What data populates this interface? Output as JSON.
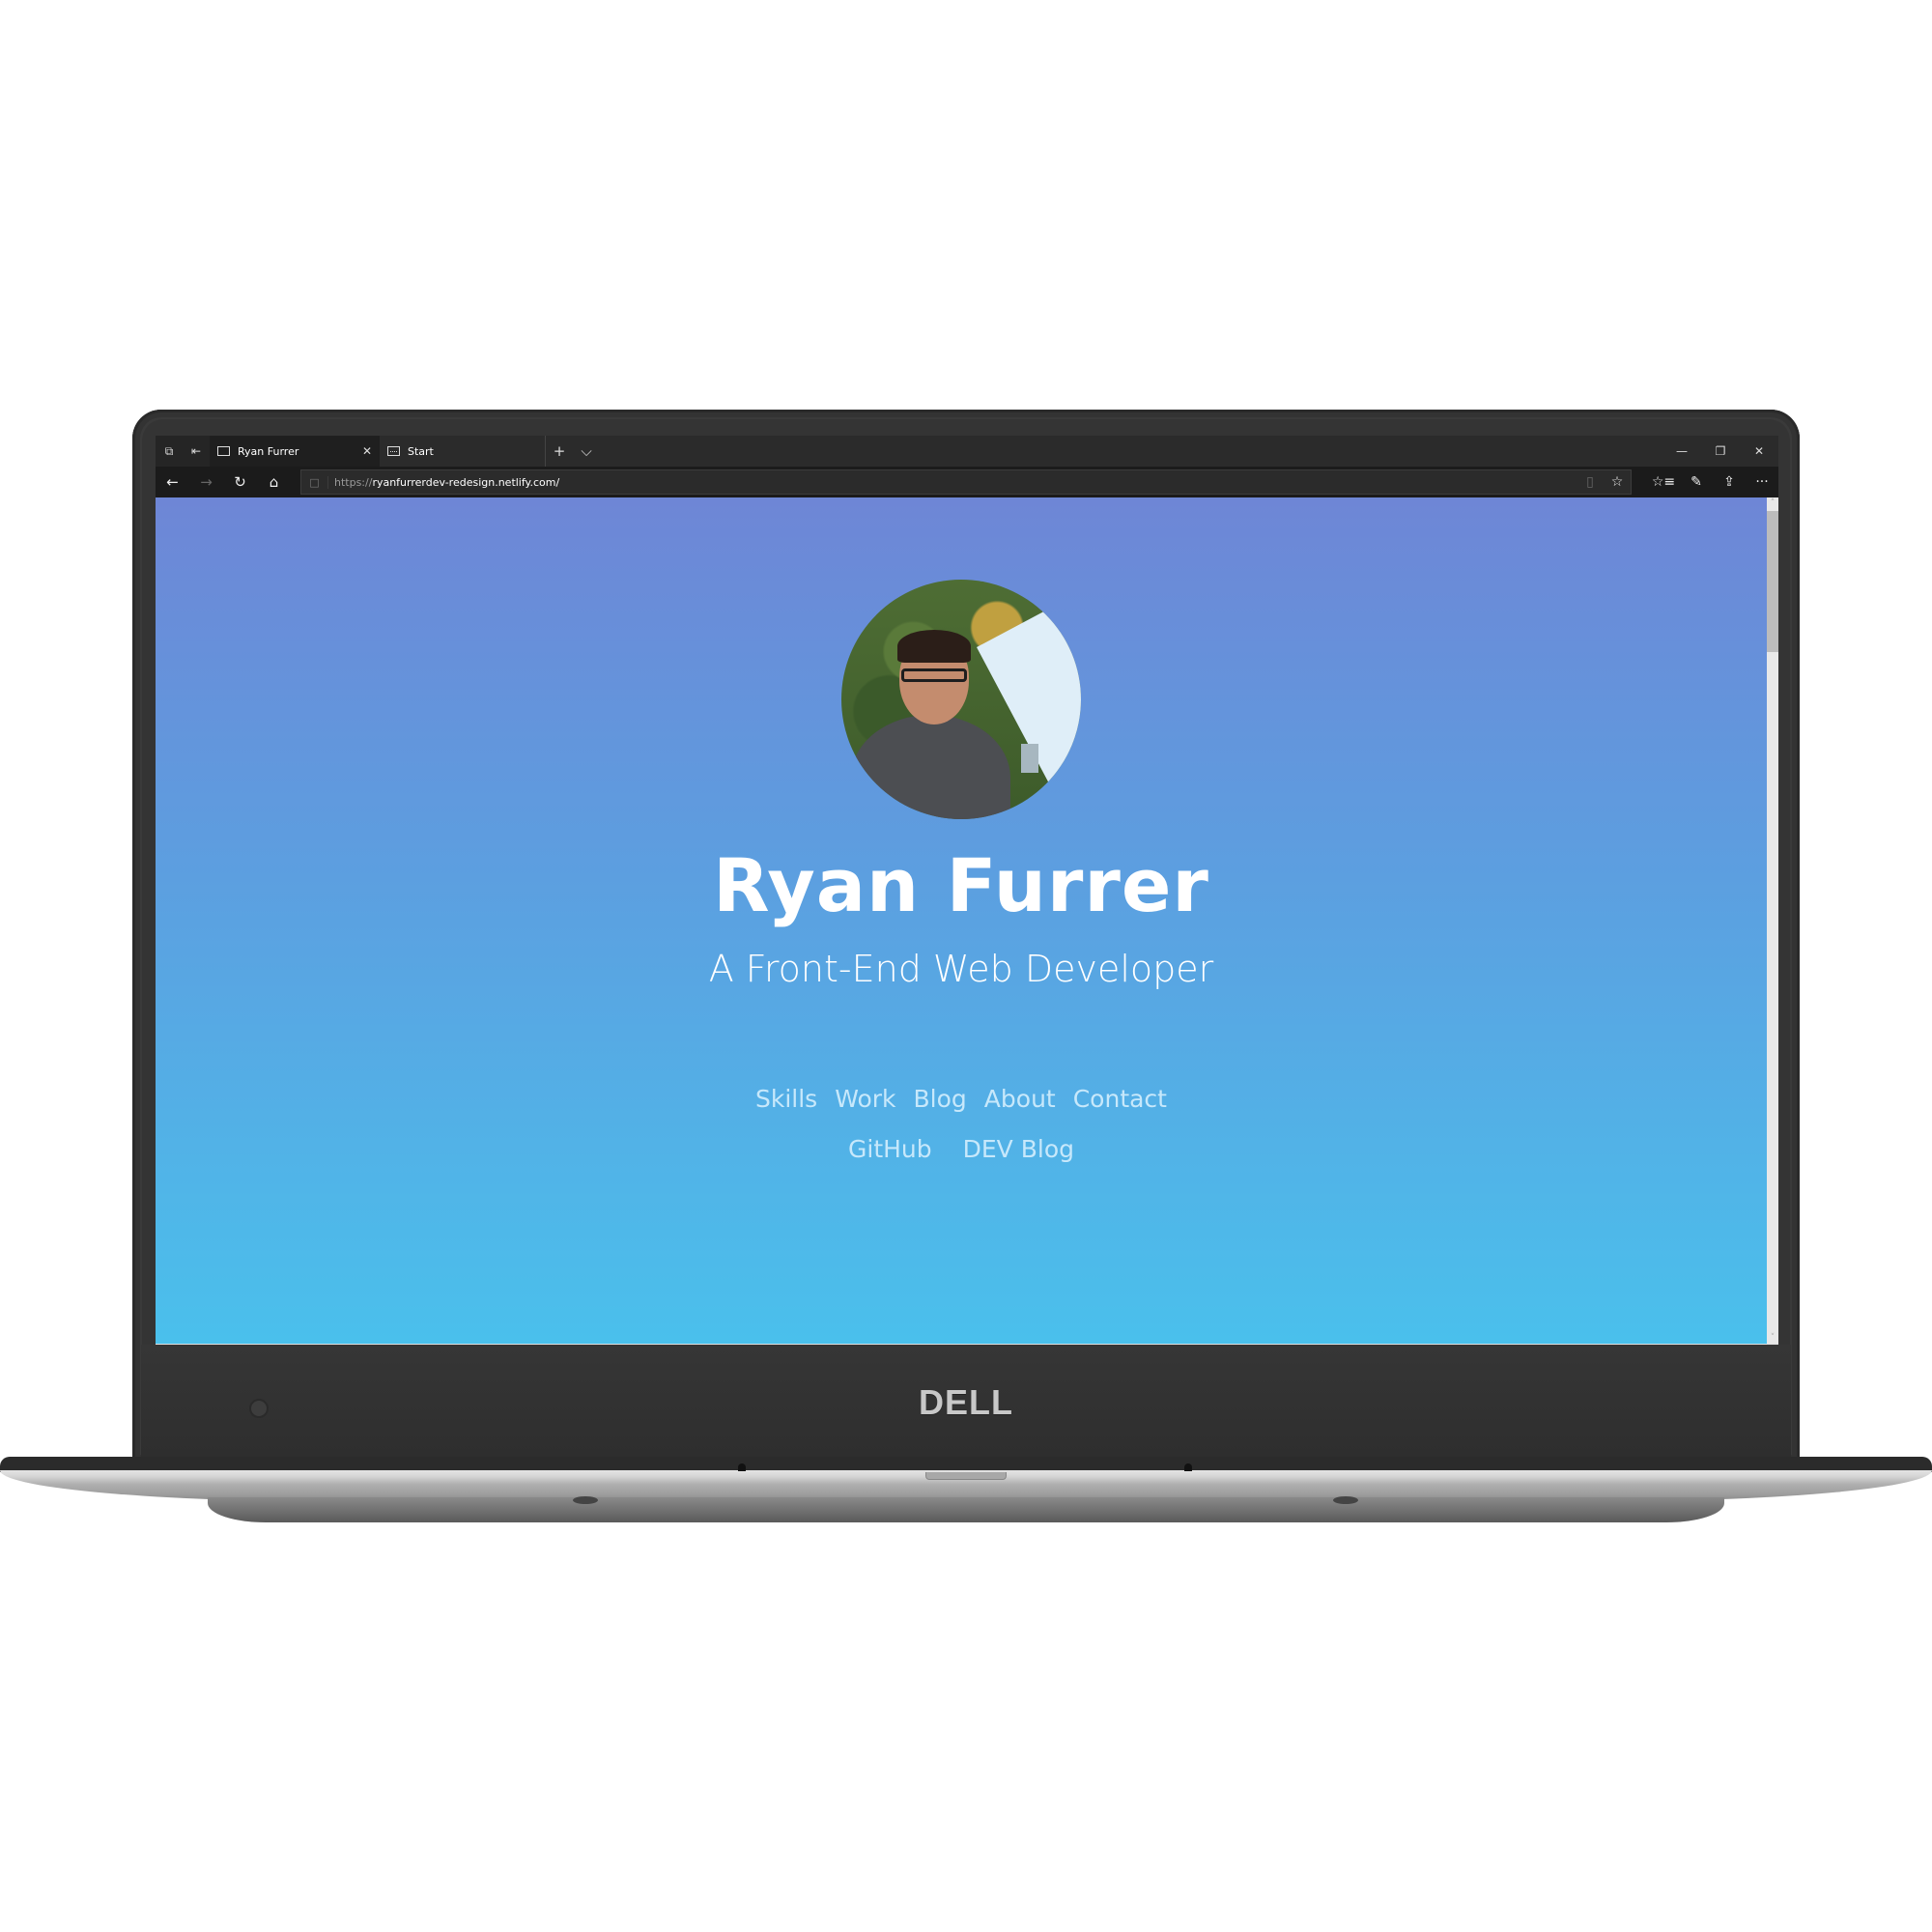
{
  "browser": {
    "tabs": [
      {
        "title": "Ryan Furrer",
        "active": true,
        "icon": "page-icon"
      },
      {
        "title": "Start",
        "active": false,
        "icon": "start-page-icon"
      }
    ],
    "tab_tools": {
      "set_aside_icon": "⧉",
      "restore_tabs_icon": "⇤"
    },
    "new_tab_icon": "+",
    "tab_list_icon": "⌵",
    "window_controls": {
      "minimize": "—",
      "restore": "❐",
      "close": "✕"
    },
    "nav": {
      "back": "←",
      "forward": "→",
      "refresh": "↻",
      "home": "⌂"
    },
    "address": {
      "scheme": "https://",
      "host_path": "ryanfurrerdev-redesign.netlify.com/",
      "lock_icon": "🔒",
      "reading_view_icon": "▯",
      "favorite_icon": "☆"
    },
    "toolbar": {
      "favorites_icon": "☆≡",
      "notes_icon": "✎",
      "share_icon": "⇪",
      "more_icon": "···"
    },
    "scrollbar": {
      "up": "˄",
      "down": "˅"
    }
  },
  "page": {
    "name": "Ryan Furrer",
    "subtitle": "A Front-End Web Developer",
    "nav_links": [
      "Skills",
      "Work",
      "Blog",
      "About",
      "Contact"
    ],
    "external_links": [
      "GitHub",
      "DEV Blog"
    ],
    "gradient": {
      "top": "#6e86d6",
      "bottom": "#4ac0ec"
    },
    "link_color": "#c7e8fb"
  },
  "device": {
    "brand": "DELL"
  }
}
